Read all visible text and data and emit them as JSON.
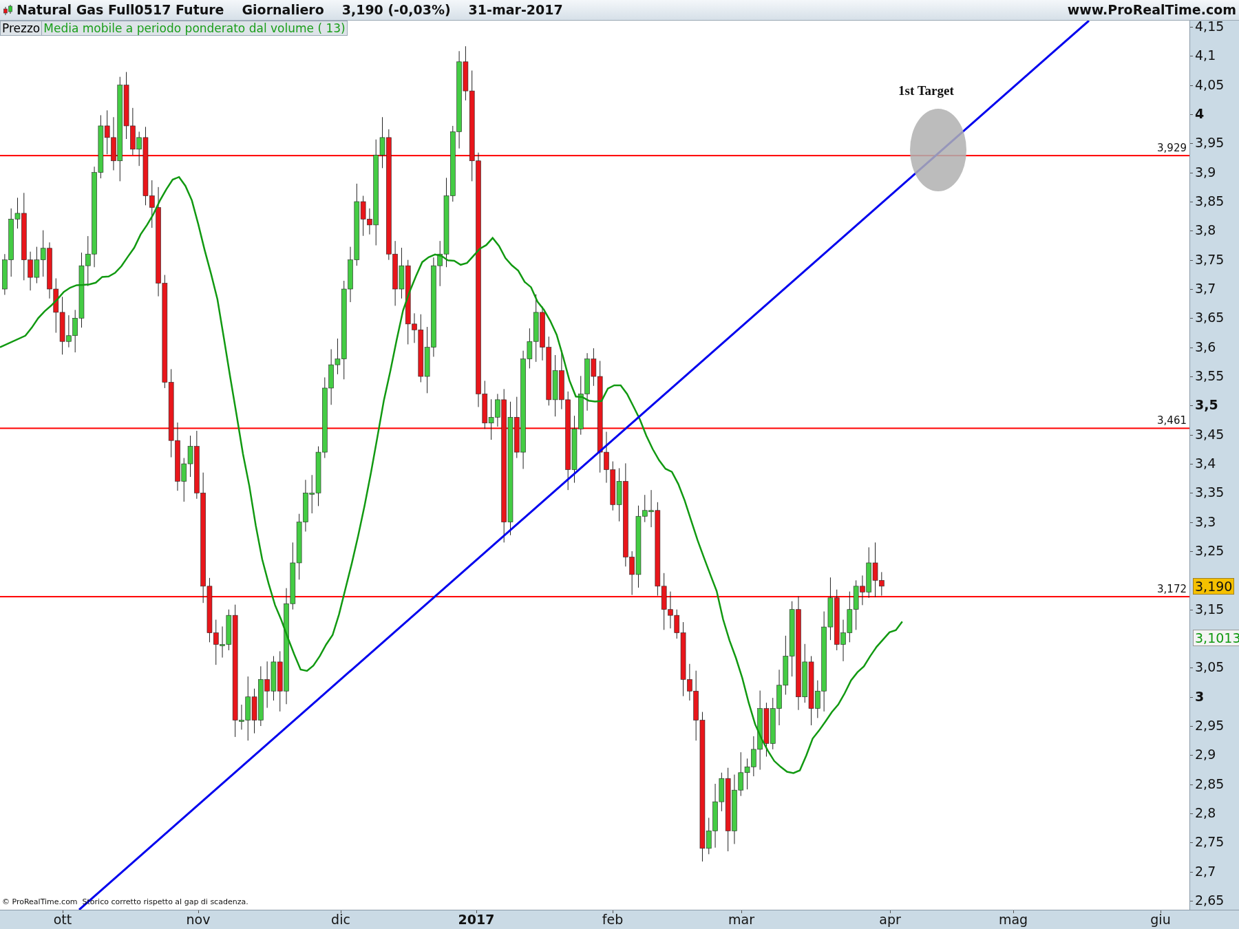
{
  "header": {
    "instrument": "Natural Gas Full0517 Future",
    "period": "Giornaliero",
    "price": "3,190 (-0,03%)",
    "date": "31-mar-2017",
    "site": "www.ProRealTime.com"
  },
  "legend": [
    {
      "label": "Prezzo",
      "color": "#000000"
    },
    {
      "label": "Media mobile a periodo ponderato dal volume ( 13)",
      "color": "#1a9e1a"
    }
  ],
  "annotation": "1st Target",
  "levels": [
    {
      "label": "3,929"
    },
    {
      "label": "3,461"
    },
    {
      "label": "3,172"
    }
  ],
  "price_badges": [
    {
      "label": "3,190",
      "kind": "last"
    },
    {
      "label": "3,1013",
      "kind": "average"
    }
  ],
  "y_axis": {
    "upper_ticks": [
      {
        "label": "4,15",
        "kind": "normal"
      },
      {
        "label": "4,1",
        "kind": "normal"
      },
      {
        "label": "4,05",
        "kind": "normal"
      },
      {
        "label": "4",
        "kind": "bold"
      },
      {
        "label": "3,95",
        "kind": "normal"
      },
      {
        "label": "3,9",
        "kind": "normal"
      },
      {
        "label": "3,85",
        "kind": "normal"
      },
      {
        "label": "3,8",
        "kind": "normal"
      },
      {
        "label": "3,75",
        "kind": "normal"
      },
      {
        "label": "3,7",
        "kind": "normal"
      },
      {
        "label": "3,65",
        "kind": "normal"
      },
      {
        "label": "3,6",
        "kind": "normal"
      },
      {
        "label": "3,55",
        "kind": "normal"
      },
      {
        "label": "3,5",
        "kind": "bold"
      },
      {
        "label": "3,45",
        "kind": "normal"
      },
      {
        "label": "3,4",
        "kind": "normal"
      },
      {
        "label": "3,35",
        "kind": "normal"
      },
      {
        "label": "3,3",
        "kind": "normal"
      },
      {
        "label": "3,25",
        "kind": "normal"
      }
    ],
    "lower_ticks": [
      {
        "label": "3,15",
        "kind": "normal"
      },
      {
        "label": "3,05",
        "kind": "normal"
      },
      {
        "label": "3",
        "kind": "bold"
      },
      {
        "label": "2,95",
        "kind": "normal"
      },
      {
        "label": "2,9",
        "kind": "normal"
      },
      {
        "label": "2,85",
        "kind": "normal"
      },
      {
        "label": "2,8",
        "kind": "normal"
      },
      {
        "label": "2,75",
        "kind": "normal"
      },
      {
        "label": "2,7",
        "kind": "normal"
      },
      {
        "label": "2,65",
        "kind": "normal"
      }
    ]
  },
  "x_axis": [
    {
      "label": "ott",
      "kind": "month"
    },
    {
      "label": "nov",
      "kind": "month"
    },
    {
      "label": "dic",
      "kind": "month"
    },
    {
      "label": "2017",
      "kind": "year"
    },
    {
      "label": "feb",
      "kind": "month"
    },
    {
      "label": "mar",
      "kind": "month"
    },
    {
      "label": "apr",
      "kind": "month"
    },
    {
      "label": "mag",
      "kind": "month"
    },
    {
      "label": "giu",
      "kind": "month"
    }
  ],
  "footer": "© ProRealTime.com  Storico corretto rispetto al gap di scadenza."
}
